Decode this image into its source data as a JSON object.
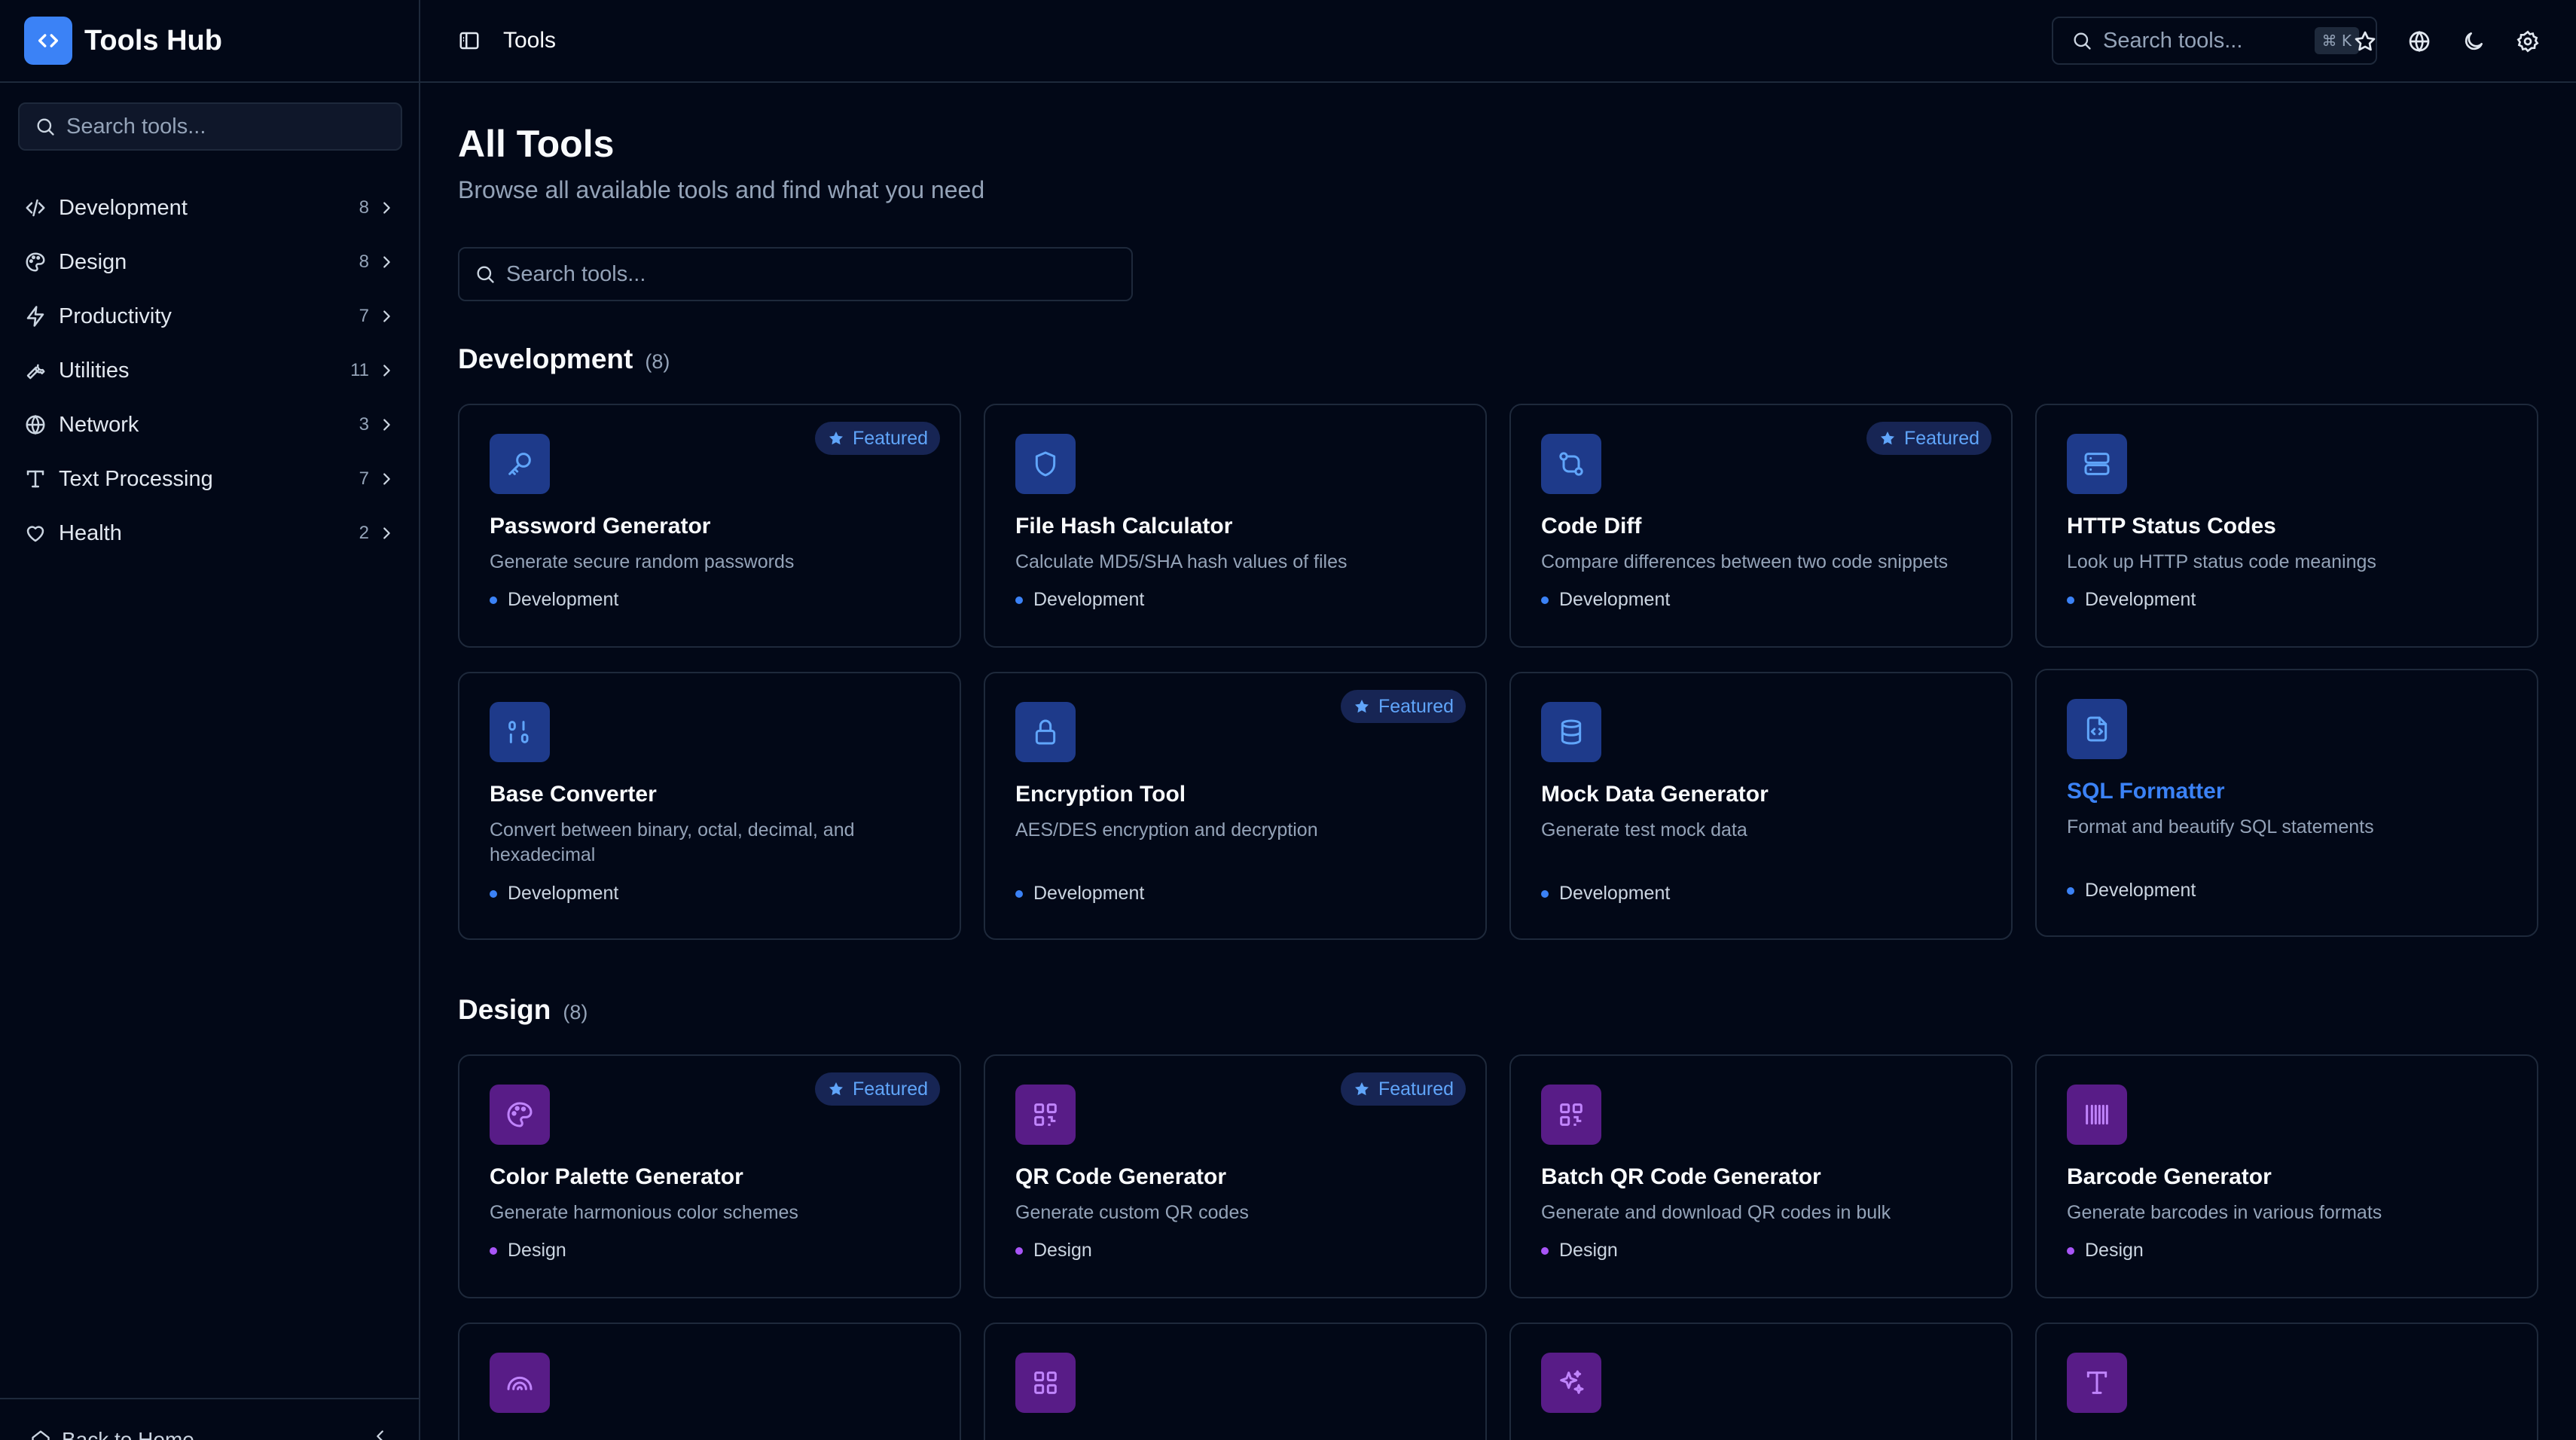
{
  "app": {
    "name": "Tools Hub"
  },
  "sidebar": {
    "search_placeholder": "Search tools...",
    "items": [
      {
        "label": "Development",
        "count": "8",
        "icon": "code-icon"
      },
      {
        "label": "Design",
        "count": "8",
        "icon": "palette-icon"
      },
      {
        "label": "Productivity",
        "count": "7",
        "icon": "zap-icon"
      },
      {
        "label": "Utilities",
        "count": "11",
        "icon": "wrench-icon"
      },
      {
        "label": "Network",
        "count": "3",
        "icon": "globe-icon"
      },
      {
        "label": "Text Processing",
        "count": "7",
        "icon": "type-icon"
      },
      {
        "label": "Health",
        "count": "2",
        "icon": "heart-icon"
      }
    ],
    "footer_label": "Back to Home"
  },
  "header": {
    "breadcrumb": "Tools",
    "search_placeholder": "Search tools...",
    "shortcut": "⌘ K"
  },
  "main": {
    "title": "All Tools",
    "subtitle": "Browse all available tools and find what you need",
    "search_placeholder": "Search tools...",
    "featured_label": "Featured",
    "sections": [
      {
        "name": "Development",
        "count": "(8)",
        "tools": [
          {
            "title": "Password Generator",
            "desc": "Generate secure random passwords",
            "tag": "Development",
            "featured": true,
            "icon": "key-icon"
          },
          {
            "title": "File Hash Calculator",
            "desc": "Calculate MD5/SHA hash values of files",
            "tag": "Development",
            "featured": false,
            "icon": "shield-icon"
          },
          {
            "title": "Code Diff",
            "desc": "Compare differences between two code snippets",
            "tag": "Development",
            "featured": true,
            "icon": "git-compare-icon"
          },
          {
            "title": "HTTP Status Codes",
            "desc": "Look up HTTP status code meanings",
            "tag": "Development",
            "featured": false,
            "icon": "server-icon"
          },
          {
            "title": "Base Converter",
            "desc": "Convert between binary, octal, decimal, and hexadecimal",
            "tag": "Development",
            "featured": false,
            "icon": "binary-icon"
          },
          {
            "title": "Encryption Tool",
            "desc": "AES/DES encryption and decryption",
            "tag": "Development",
            "featured": true,
            "icon": "lock-icon"
          },
          {
            "title": "Mock Data Generator",
            "desc": "Generate test mock data",
            "tag": "Development",
            "featured": false,
            "icon": "database-icon"
          },
          {
            "title": "SQL Formatter",
            "desc": "Format and beautify SQL statements",
            "tag": "Development",
            "featured": false,
            "icon": "file-code-icon"
          }
        ]
      },
      {
        "name": "Design",
        "count": "(8)",
        "tools": [
          {
            "title": "Color Palette Generator",
            "desc": "Generate harmonious color schemes",
            "tag": "Design",
            "featured": true,
            "icon": "palette-icon"
          },
          {
            "title": "QR Code Generator",
            "desc": "Generate custom QR codes",
            "tag": "Design",
            "featured": true,
            "icon": "qr-code-icon"
          },
          {
            "title": "Batch QR Code Generator",
            "desc": "Generate and download QR codes in bulk",
            "tag": "Design",
            "featured": false,
            "icon": "qr-code-icon"
          },
          {
            "title": "Barcode Generator",
            "desc": "Generate barcodes in various formats",
            "tag": "Design",
            "featured": false,
            "icon": "barcode-icon"
          },
          {
            "icon": "rainbow-icon"
          },
          {
            "icon": "grid-icon"
          },
          {
            "icon": "sparkles-icon"
          },
          {
            "icon": "type-icon"
          }
        ]
      }
    ]
  },
  "colors": {
    "accent": "#3b82f6",
    "design_accent": "#a855f7",
    "background": "#020817",
    "border": "#1e293b"
  }
}
